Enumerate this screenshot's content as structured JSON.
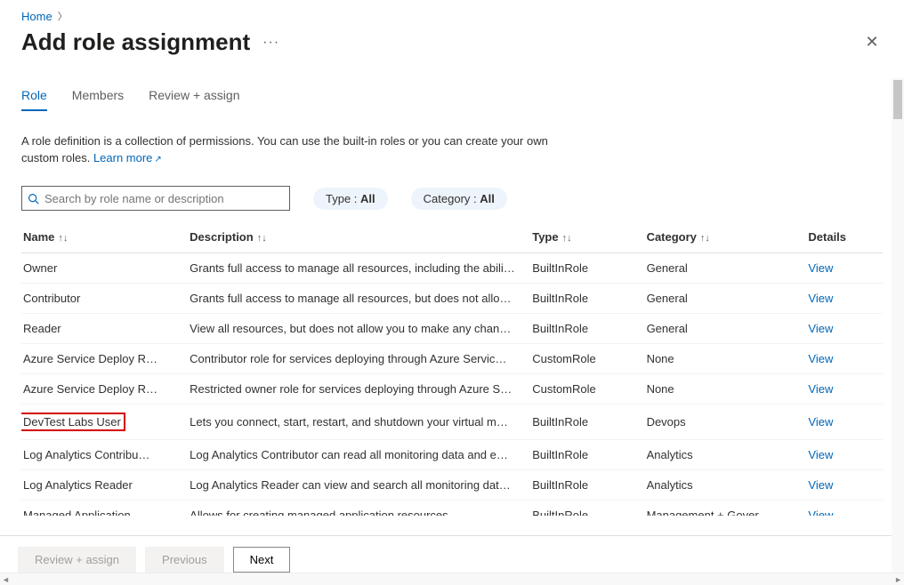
{
  "breadcrumb": {
    "home": "Home"
  },
  "page_title": "Add role assignment",
  "tabs": {
    "role": "Role",
    "members": "Members",
    "review": "Review + assign"
  },
  "description": "A role definition is a collection of permissions. You can use the built-in roles or you can create your own custom roles.",
  "learn_more": "Learn more",
  "search": {
    "placeholder": "Search by role name or description"
  },
  "filters": {
    "type_label": "Type : ",
    "type_value": "All",
    "category_label": "Category : ",
    "category_value": "All"
  },
  "columns": {
    "name": "Name",
    "description": "Description",
    "type": "Type",
    "category": "Category",
    "details": "Details"
  },
  "view_label": "View",
  "rows": [
    {
      "name": "Owner",
      "desc": "Grants full access to manage all resources, including the abili…",
      "type": "BuiltInRole",
      "category": "General"
    },
    {
      "name": "Contributor",
      "desc": "Grants full access to manage all resources, but does not allo…",
      "type": "BuiltInRole",
      "category": "General"
    },
    {
      "name": "Reader",
      "desc": "View all resources, but does not allow you to make any chan…",
      "type": "BuiltInRole",
      "category": "General"
    },
    {
      "name": "Azure Service Deploy R…",
      "desc": "Contributor role for services deploying through Azure Servic…",
      "type": "CustomRole",
      "category": "None"
    },
    {
      "name": "Azure Service Deploy R…",
      "desc": "Restricted owner role for services deploying through Azure S…",
      "type": "CustomRole",
      "category": "None"
    },
    {
      "name": "DevTest Labs User",
      "desc": "Lets you connect, start, restart, and shutdown your virtual m…",
      "type": "BuiltInRole",
      "category": "Devops",
      "highlighted": true
    },
    {
      "name": "Log Analytics Contribu…",
      "desc": "Log Analytics Contributor can read all monitoring data and e…",
      "type": "BuiltInRole",
      "category": "Analytics"
    },
    {
      "name": "Log Analytics Reader",
      "desc": "Log Analytics Reader can view and search all monitoring dat…",
      "type": "BuiltInRole",
      "category": "Analytics"
    },
    {
      "name": "Managed Application …",
      "desc": "Allows for creating managed application resources.",
      "type": "BuiltInRole",
      "category": "Management + Gover…"
    }
  ],
  "buttons": {
    "review": "Review + assign",
    "previous": "Previous",
    "next": "Next"
  }
}
